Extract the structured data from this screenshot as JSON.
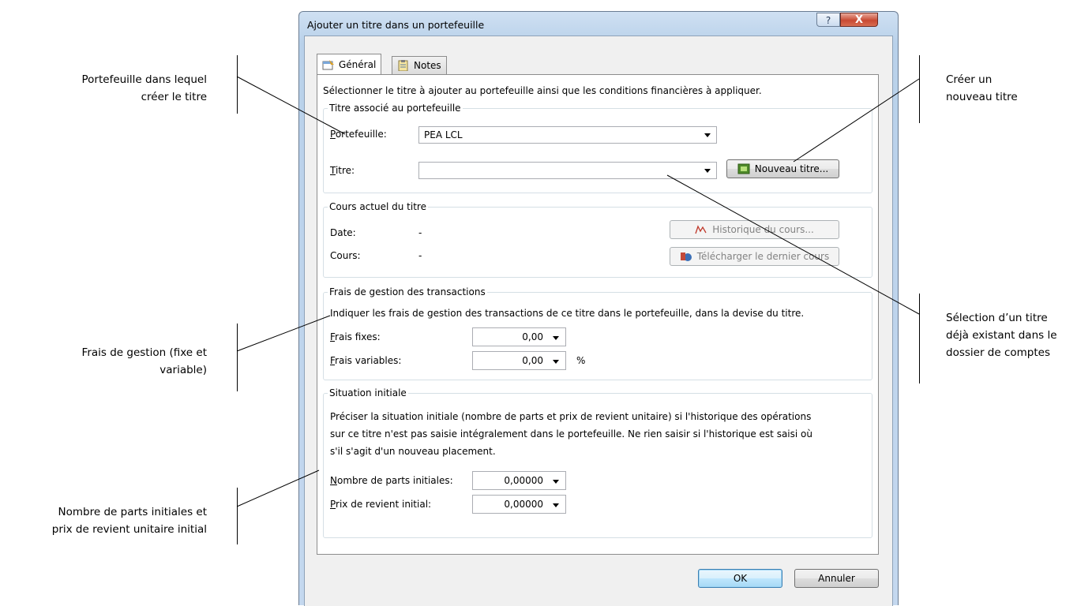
{
  "annotations": {
    "portefeuille": [
      "Portefeuille dans lequel",
      "créer le titre"
    ],
    "nouveau_titre": [
      "Créer un",
      "nouveau titre"
    ],
    "selection_titre": [
      "Sélection d’un titre",
      "déjà existant dans le",
      "dossier de comptes"
    ],
    "frais": [
      "Frais de gestion (fixe et",
      "variable)"
    ],
    "parts": [
      "Nombre de parts initiales et",
      "prix de revient unitaire initial"
    ]
  },
  "window": {
    "title": "Ajouter un titre dans un portefeuille",
    "help_glyph": "?",
    "close_glyph": "X"
  },
  "tabs": [
    {
      "label": "Général",
      "icon": "properties-icon"
    },
    {
      "label": "Notes",
      "icon": "clipboard-icon"
    }
  ],
  "intro_text": "Sélectionner le titre à ajouter au portefeuille ainsi que les conditions financières à appliquer.",
  "titre_group": {
    "title": "Titre associé au portefeuille",
    "portefeuille_label_u": "P",
    "portefeuille_label_rest": "ortefeuille:",
    "portefeuille_value": "PEA LCL",
    "titre_label_u": "T",
    "titre_label_rest": "itre:",
    "titre_value": "",
    "new_button": "Nouveau titre..."
  },
  "cours_group": {
    "title": "Cours actuel du titre",
    "date_label": "Date:",
    "date_value": "-",
    "cours_label": "Cours:",
    "cours_value": "-",
    "history_button": "Historique du cours...",
    "download_button": "Télécharger le dernier cours"
  },
  "frais_group": {
    "title": "Frais de gestion des transactions",
    "description": "Indiquer les frais de gestion des transactions de ce titre dans le portefeuille, dans la devise du titre.",
    "fixes_label_u": "F",
    "fixes_label_rest": "rais fixes:",
    "fixes_value": "0,00",
    "variables_label_u": "F",
    "variables_label_rest": "rais variables:",
    "variables_value": "0,00",
    "percent": "%"
  },
  "situation_group": {
    "title": "Situation initiale",
    "description": [
      "Préciser la situation initiale (nombre de parts et prix de revient unitaire) si l'historique des opérations",
      "sur ce titre n'est pas saisie intégralement dans le portefeuille. Ne rien saisir si l'historique est saisi où",
      "s'il s'agit d'un nouveau placement."
    ],
    "parts_label_u": "N",
    "parts_label_rest": "ombre de parts initiales:",
    "parts_value": "0,00000",
    "prix_label_u": "P",
    "prix_label_rest": "rix de revient initial:",
    "prix_value": "0,00000"
  },
  "buttons": {
    "ok": "OK",
    "cancel": "Annuler"
  }
}
